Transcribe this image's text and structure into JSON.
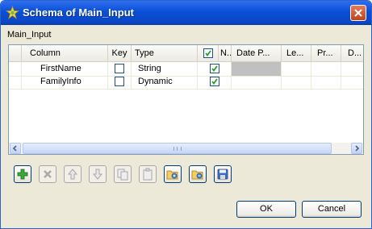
{
  "window": {
    "title": "Schema of Main_Input",
    "icon": "talend-star-icon",
    "close_icon": "close-icon"
  },
  "group_label": "Main_Input",
  "table": {
    "columns": [
      "Column",
      "Key",
      "Type",
      "",
      "N...",
      "Date P...",
      "Le...",
      "Pr...",
      "D..."
    ],
    "rows": [
      {
        "column": "FirstName",
        "key": false,
        "type": "String",
        "nullable": true
      },
      {
        "column": "FamilyInfo",
        "key": false,
        "type": "Dynamic",
        "nullable": true
      }
    ],
    "nullable_header_checked": true
  },
  "toolbar": {
    "buttons": [
      {
        "name": "add-button",
        "icon": "plus-icon",
        "enabled": true
      },
      {
        "name": "remove-button",
        "icon": "x-icon",
        "enabled": false
      },
      {
        "name": "move-up-button",
        "icon": "arrow-up-icon",
        "enabled": false
      },
      {
        "name": "move-down-button",
        "icon": "arrow-down-icon",
        "enabled": false
      },
      {
        "name": "copy-button",
        "icon": "copy-icon",
        "enabled": false
      },
      {
        "name": "paste-button",
        "icon": "paste-icon",
        "enabled": false
      },
      {
        "name": "import-button",
        "icon": "folder-import-icon",
        "enabled": true
      },
      {
        "name": "export-button",
        "icon": "folder-export-icon",
        "enabled": true
      },
      {
        "name": "save-button",
        "icon": "disk-save-icon",
        "enabled": true
      }
    ]
  },
  "buttons": {
    "ok": "OK",
    "cancel": "Cancel"
  },
  "colors": {
    "titlebar": "#0a4fd6",
    "dialog_bg": "#ece9d8",
    "add_icon": "#2e9b2e",
    "grey_cell": "#c0c0c0"
  }
}
